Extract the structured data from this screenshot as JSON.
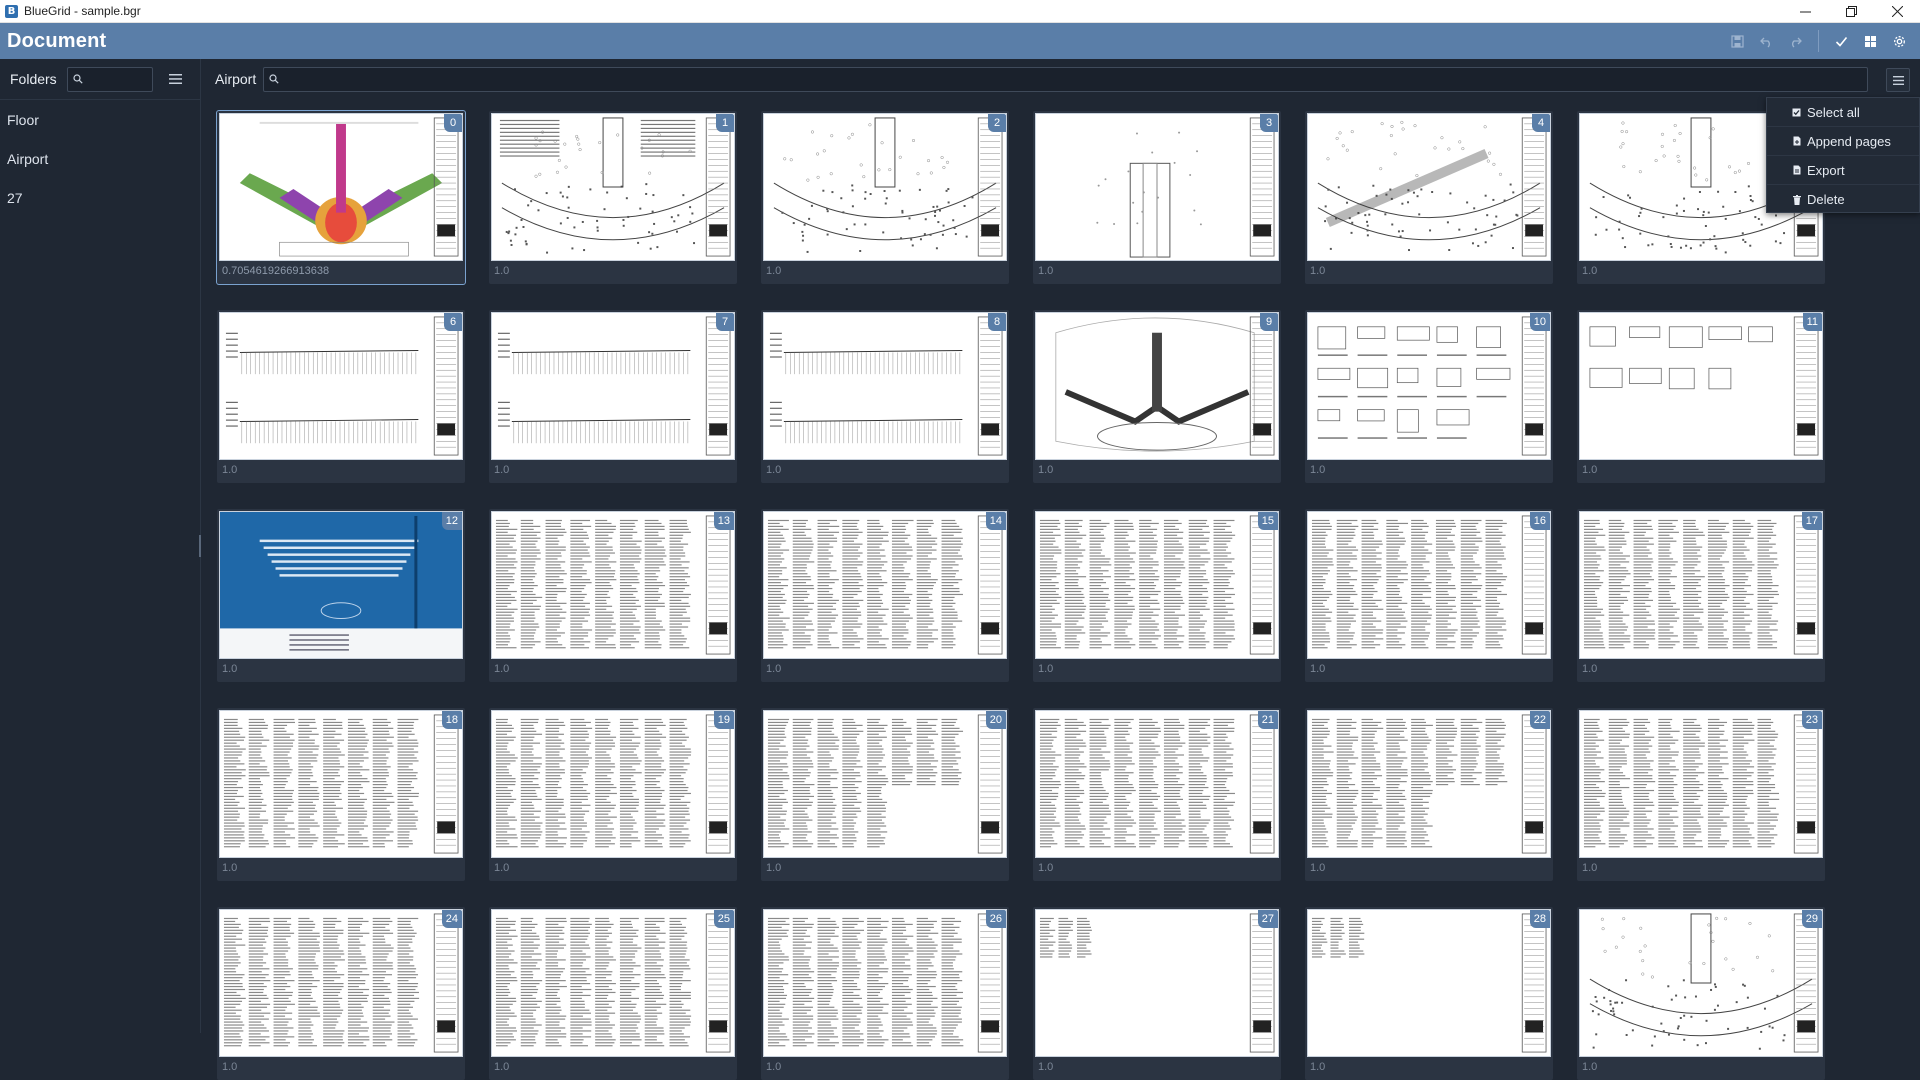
{
  "window": {
    "title": "BlueGrid - sample.bgr",
    "controls": [
      "minimize-icon",
      "restore-icon",
      "close-icon"
    ]
  },
  "header": {
    "title": "Document",
    "tools": [
      "save-icon",
      "undo-icon",
      "redo-icon",
      "check-icon",
      "grid-view-icon",
      "settings-icon"
    ]
  },
  "sidebar": {
    "label": "Folders",
    "search_placeholder": "",
    "folders": [
      {
        "label": "Floor"
      },
      {
        "label": "Airport"
      },
      {
        "label": "27"
      }
    ]
  },
  "main": {
    "label": "Airport",
    "search_placeholder": "",
    "pages": [
      {
        "index": "0",
        "scale": "0.7054619266913638",
        "kind": "color-plan",
        "selected": true
      },
      {
        "index": "1",
        "scale": "1.0",
        "kind": "plan-notes"
      },
      {
        "index": "2",
        "scale": "1.0",
        "kind": "plan"
      },
      {
        "index": "3",
        "scale": "1.0",
        "kind": "sparse"
      },
      {
        "index": "4",
        "scale": "1.0",
        "kind": "plan-diag"
      },
      {
        "index": "5",
        "scale": "1.0",
        "kind": "plan"
      },
      {
        "index": "6",
        "scale": "1.0",
        "kind": "section"
      },
      {
        "index": "7",
        "scale": "1.0",
        "kind": "section"
      },
      {
        "index": "8",
        "scale": "1.0",
        "kind": "section"
      },
      {
        "index": "9",
        "scale": "1.0",
        "kind": "site"
      },
      {
        "index": "10",
        "scale": "1.0",
        "kind": "details"
      },
      {
        "index": "11",
        "scale": "1.0",
        "kind": "details-sparse"
      },
      {
        "index": "12",
        "scale": "1.0",
        "kind": "cover"
      },
      {
        "index": "13",
        "scale": "1.0",
        "kind": "table"
      },
      {
        "index": "14",
        "scale": "1.0",
        "kind": "table"
      },
      {
        "index": "15",
        "scale": "1.0",
        "kind": "table"
      },
      {
        "index": "16",
        "scale": "1.0",
        "kind": "table"
      },
      {
        "index": "17",
        "scale": "1.0",
        "kind": "table"
      },
      {
        "index": "18",
        "scale": "1.0",
        "kind": "table"
      },
      {
        "index": "19",
        "scale": "1.0",
        "kind": "table"
      },
      {
        "index": "20",
        "scale": "1.0",
        "kind": "table-partial"
      },
      {
        "index": "21",
        "scale": "1.0",
        "kind": "table"
      },
      {
        "index": "22",
        "scale": "1.0",
        "kind": "table-partial"
      },
      {
        "index": "23",
        "scale": "1.0",
        "kind": "table"
      },
      {
        "index": "24",
        "scale": "1.0",
        "kind": "table"
      },
      {
        "index": "25",
        "scale": "1.0",
        "kind": "table"
      },
      {
        "index": "26",
        "scale": "1.0",
        "kind": "table"
      },
      {
        "index": "27",
        "scale": "1.0",
        "kind": "table-small"
      },
      {
        "index": "28",
        "scale": "1.0",
        "kind": "table-small"
      },
      {
        "index": "29",
        "scale": "1.0",
        "kind": "plan"
      }
    ]
  },
  "menu": {
    "items": [
      {
        "label": "Select all",
        "icon": "checkbox-icon"
      },
      {
        "label": "Append pages",
        "icon": "append-pages-icon"
      },
      {
        "label": "Export",
        "icon": "export-icon"
      },
      {
        "label": "Delete",
        "icon": "trash-icon"
      }
    ]
  },
  "colors": {
    "header": "#5a7ea8",
    "background": "#1f2733",
    "card": "#2b3442",
    "badge": "#5a7ea8",
    "cover": "#1f68a8"
  }
}
